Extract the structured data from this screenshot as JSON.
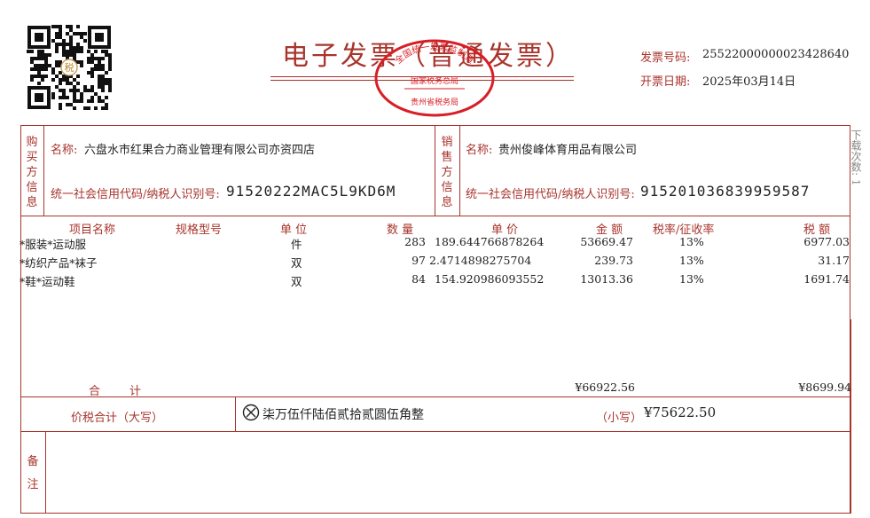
{
  "header": {
    "title": "电子发票（普通发票）",
    "invoice_no_label": "发票号码:",
    "invoice_no": "25522000000023428640",
    "issue_date_label": "开票日期:",
    "issue_date": "2025年03月14日"
  },
  "seal": {
    "top_text": "全国统一发票监制章",
    "middle_text": "国家税务总局",
    "bottom_text": "贵州省税务局",
    "color": "#d81e25"
  },
  "qr_badge": "税",
  "side_note": "下载次数: 1",
  "buyer": {
    "section_label": "购买方信息",
    "name_label": "名称:",
    "name": "六盘水市红果合力商业管理有限公司亦资四店",
    "tax_label": "统一社会信用代码/纳税人识别号:",
    "tax_id": "91520222MAC5L9KD6M"
  },
  "seller": {
    "section_label": "销售方信息",
    "name_label": "名称:",
    "name": "贵州俊峰体育用品有限公司",
    "tax_label": "统一社会信用代码/纳税人识别号:",
    "tax_id": "915201036839959587"
  },
  "table": {
    "headers": {
      "item": "项目名称",
      "spec": "规格型号",
      "unit": "单  位",
      "qty": "数  量",
      "price": "单  价",
      "amount": "金  额",
      "rate": "税率/征收率",
      "tax": "税  额"
    },
    "rows": [
      {
        "item": "*服装*运动服",
        "spec": "",
        "unit": "件",
        "qty": "283",
        "price": "189.644766878264",
        "amount": "53669.47",
        "rate": "13%",
        "tax": "6977.03"
      },
      {
        "item": "*纺织产品*袜子",
        "spec": "",
        "unit": "双",
        "qty": "97",
        "price": "2.4714898275704",
        "amount": "239.73",
        "rate": "13%",
        "tax": "31.17"
      },
      {
        "item": "*鞋*运动鞋",
        "spec": "",
        "unit": "双",
        "qty": "84",
        "price": "154.920986093552",
        "amount": "13013.36",
        "rate": "13%",
        "tax": "1691.74"
      }
    ],
    "total_label": "合        计",
    "total_amount": "¥66922.56",
    "total_tax": "¥8699.94"
  },
  "summary": {
    "label": "价税合计（大写）",
    "upper": "柒万伍仟陆佰贰拾贰圆伍角整",
    "lower_label": "（小写）",
    "lower": "¥75622.50"
  },
  "remarks_label": "备注",
  "colors": {
    "primary": "#a8342c",
    "seal": "#d81e25"
  }
}
